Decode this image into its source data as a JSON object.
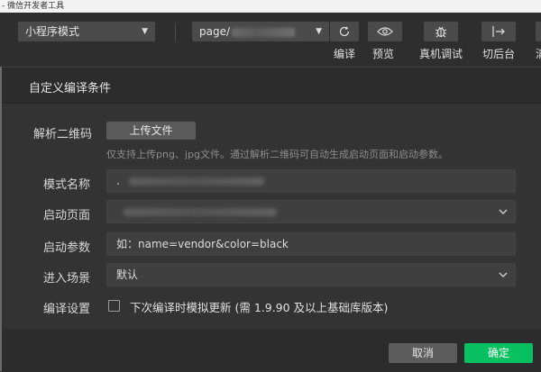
{
  "app": {
    "title_strip": "- 微信开发者工具"
  },
  "toolbar": {
    "mode_select": "小程序模式",
    "page_select": "page/",
    "buttons": [
      {
        "label": "编译",
        "icon": "refresh-icon"
      },
      {
        "label": "预览",
        "icon": "eye-icon"
      },
      {
        "label": "真机调试",
        "icon": "bug-icon"
      },
      {
        "label": "切后台",
        "icon": "switch-background-icon"
      },
      {
        "label": "清",
        "icon": "clear-cache-icon"
      }
    ]
  },
  "dialog": {
    "title": "自定义编译条件",
    "qrcode": {
      "label": "解析二维码",
      "upload_button": "上传文件",
      "hint": "仅支持上传png、jpg文件。通过解析二维码可自动生成启动页面和启动参数。"
    },
    "mode_name": {
      "label": "模式名称",
      "value": "."
    },
    "launch_page": {
      "label": "启动页面",
      "value": ""
    },
    "launch_params": {
      "label": "启动参数",
      "placeholder": "如：name=vendor&color=black"
    },
    "scene": {
      "label": "进入场景",
      "value": "默认"
    },
    "compile_settings": {
      "label": "编译设置",
      "checkbox_label": "下次编译时模拟更新 (需 1.9.90 及以上基础库版本)",
      "checked": false
    },
    "footer": {
      "cancel": "取消",
      "confirm": "确定"
    }
  },
  "colors": {
    "accent": "#07c160",
    "background": "#2e2e2e",
    "dialog": "#333333"
  }
}
